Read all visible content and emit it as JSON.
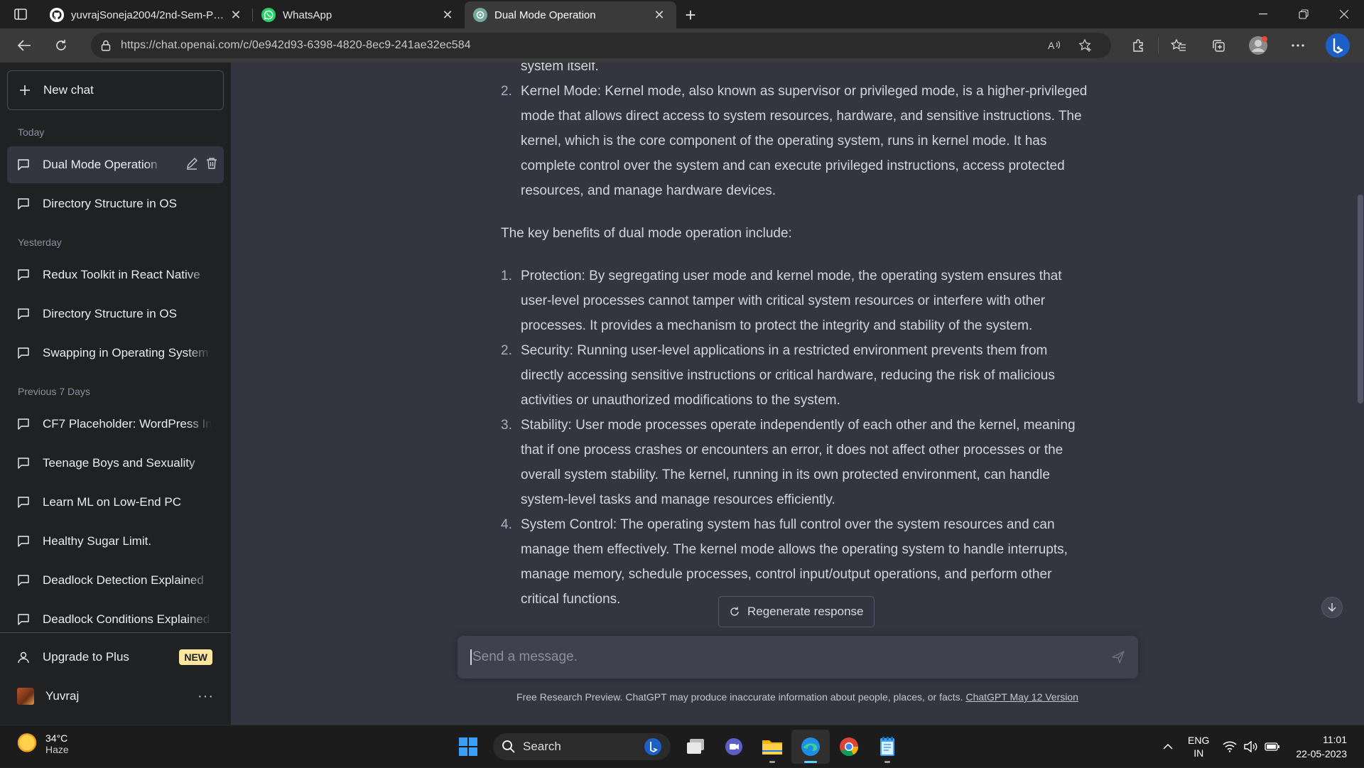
{
  "browser": {
    "tabs": [
      {
        "title": "yuvrajSoneja2004/2nd-Sem-Prep",
        "favicon": "github-icon"
      },
      {
        "title": "WhatsApp",
        "favicon": "whatsapp-icon"
      },
      {
        "title": "Dual Mode Operation",
        "favicon": "openai-icon",
        "active": true
      }
    ],
    "url_host": "https://chat.openai.com",
    "url_path": "/c/0e942d93-6398-4820-8ec9-241ae32ec584"
  },
  "sidebar": {
    "new_chat": "New chat",
    "sections": {
      "today": "Today",
      "yesterday": "Yesterday",
      "previous7": "Previous 7 Days"
    },
    "today_items": [
      "Dual Mode Operation",
      "Directory Structure in OS"
    ],
    "yesterday_items": [
      "Redux Toolkit in React Native",
      "Directory Structure in OS",
      "Swapping in Operating System"
    ],
    "previous7_items": [
      "CF7 Placeholder: WordPress In",
      "Teenage Boys and Sexuality",
      "Learn ML on Low-End PC",
      "Healthy Sugar Limit.",
      "Deadlock Detection Explained",
      "Deadlock Conditions Explained"
    ],
    "upgrade": "Upgrade to Plus",
    "upgrade_badge": "NEW",
    "user_name": "Yuvraj"
  },
  "chat": {
    "top_fragment": "system itself.",
    "list1": [
      {
        "num": "2.",
        "text": "Kernel Mode: Kernel mode, also known as supervisor or privileged mode, is a higher-privileged mode that allows direct access to system resources, hardware, and sensitive instructions. The kernel, which is the core component of the operating system, runs in kernel mode. It has complete control over the system and can execute privileged instructions, access protected resources, and manage hardware devices."
      }
    ],
    "intro": "The key benefits of dual mode operation include:",
    "list2": [
      {
        "num": "1.",
        "text": "Protection: By segregating user mode and kernel mode, the operating system ensures that user-level processes cannot tamper with critical system resources or interfere with other processes. It provides a mechanism to protect the integrity and stability of the system."
      },
      {
        "num": "2.",
        "text": "Security: Running user-level applications in a restricted environment prevents them from directly accessing sensitive instructions or critical hardware, reducing the risk of malicious activities or unauthorized modifications to the system."
      },
      {
        "num": "3.",
        "text": "Stability: User mode processes operate independently of each other and the kernel, meaning that if one process crashes or encounters an error, it does not affect other processes or the overall system stability. The kernel, running in its own protected environment, can handle system-level tasks and manage resources efficiently."
      },
      {
        "num": "4.",
        "text": "System Control: The operating system has full control over the system resources and can manage them effectively. The kernel mode allows the operating system to handle interrupts, manage memory, schedule processes, control input/output operations, and perform other critical functions."
      }
    ],
    "regenerate": "Regenerate response",
    "placeholder": "Send a message.",
    "disclaimer": "Free Research Preview. ChatGPT may produce inaccurate information about people, places, or facts.",
    "version_link": "ChatGPT May 12 Version"
  },
  "taskbar": {
    "temp": "34°C",
    "condition": "Haze",
    "search": "Search",
    "lang1": "ENG",
    "lang2": "IN",
    "time": "11:01",
    "date": "22-05-2023"
  },
  "colors": {
    "sidebar_bg": "#202123",
    "main_bg": "#343541",
    "accent_new_badge": "#fae69e"
  }
}
